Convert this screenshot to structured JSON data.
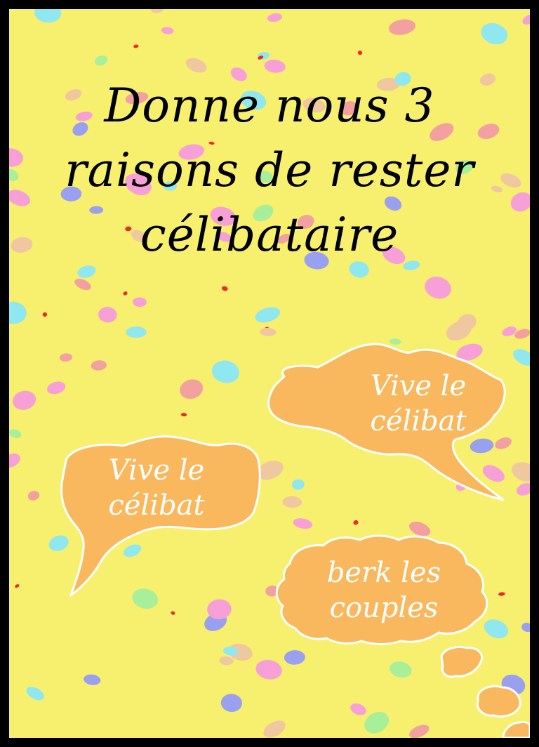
{
  "title_lines": [
    "Donne nous 3",
    "raisons de rester",
    "célibataire"
  ],
  "bubbles": [
    {
      "lines": [
        "Vive le",
        "célibat"
      ]
    },
    {
      "lines": [
        "Vive le",
        "célibat"
      ]
    },
    {
      "lines": [
        "berk les",
        "couples"
      ]
    }
  ],
  "colors": {
    "background": "#f7ef6e",
    "border": "#000000",
    "bubble_fill": "#f9b85e",
    "bubble_stroke": "#ffffff",
    "title_text": "#000000",
    "bubble_text": "#ffffff",
    "confetti": [
      "#f7a0d8",
      "#9aa0f0",
      "#a8ef9a",
      "#8fe8f0",
      "#f2a0a0",
      "#f0c8a0",
      "#ef2a2a"
    ]
  }
}
